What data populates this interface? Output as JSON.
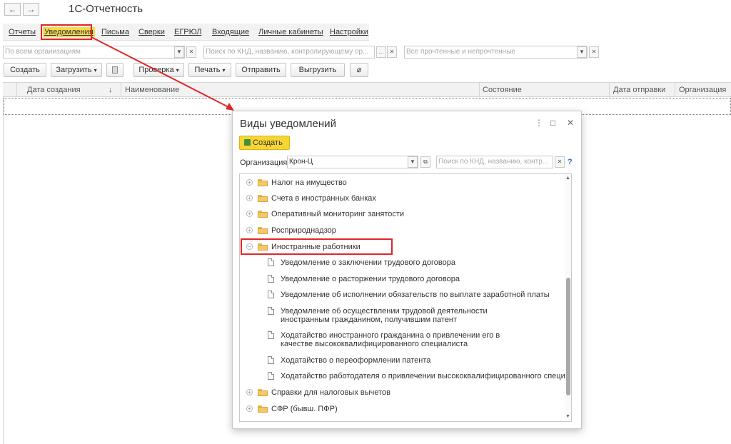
{
  "window": {
    "title": "1С-Отчетность",
    "back_glyph": "←",
    "forward_glyph": "→"
  },
  "menu": {
    "items": [
      "Отчеты",
      "Уведомления",
      "Письма",
      "Сверки",
      "ЕГРЮЛ",
      "Входящие",
      "Личные кабинеты",
      "Настройки"
    ],
    "active": "Уведомления"
  },
  "filters": {
    "organizations_placeholder": "По всем организациям",
    "search_placeholder": "Поиск по КНД, названию, контролирующему ор...",
    "read_status_placeholder": "Все прочтенные и непрочтенные"
  },
  "toolbar": {
    "create_label": "Создать",
    "load_label": "Загрузить",
    "check_label": "Проверка",
    "print_label": "Печать",
    "send_label": "Отправить",
    "export_label": "Выгрузить"
  },
  "table": {
    "columns": [
      "Дата создания",
      "Наименование",
      "Состояние",
      "Дата отправки",
      "Организация"
    ],
    "sort_glyph": "↓"
  },
  "dialog": {
    "title": "Виды уведомлений",
    "create_label": "Создать",
    "org_label": "Организация:",
    "org_value": "Крон-Ц",
    "search_placeholder": "Поиск по КНД, названию, контр...",
    "help_glyph": "?",
    "more_glyph": "⋮",
    "maximize_glyph": "□",
    "close_glyph": "✕"
  },
  "tree": {
    "folders_top": [
      "Налог на имущество",
      "Счета в иностранных банках",
      "Оперативный мониторинг занятости",
      "Росприроднадзор"
    ],
    "expanded_folder": "Иностранные работники",
    "documents": [
      "Уведомление о заключении трудового договора",
      "Уведомление о расторжении трудового договора",
      "Уведомление об исполнении обязательств по выплате заработной платы",
      "Уведомление об осуществлении трудовой деятельности иностранным гражданином, получившим патент",
      "Ходатайство иностранного гражданина о привлечении его в качестве высококвалифицированного специалиста",
      "Ходатайство о переоформлении патента",
      "Ходатайство работодателя о привлечении высококвалифицированного специалиста"
    ],
    "folders_bottom": [
      "Справки для налоговых вычетов",
      "СФР (бывш. ПФР)"
    ]
  },
  "colors": {
    "highlight": "#e2262a",
    "accent_yellow": "#f7d633",
    "folder": "#f3c867"
  }
}
